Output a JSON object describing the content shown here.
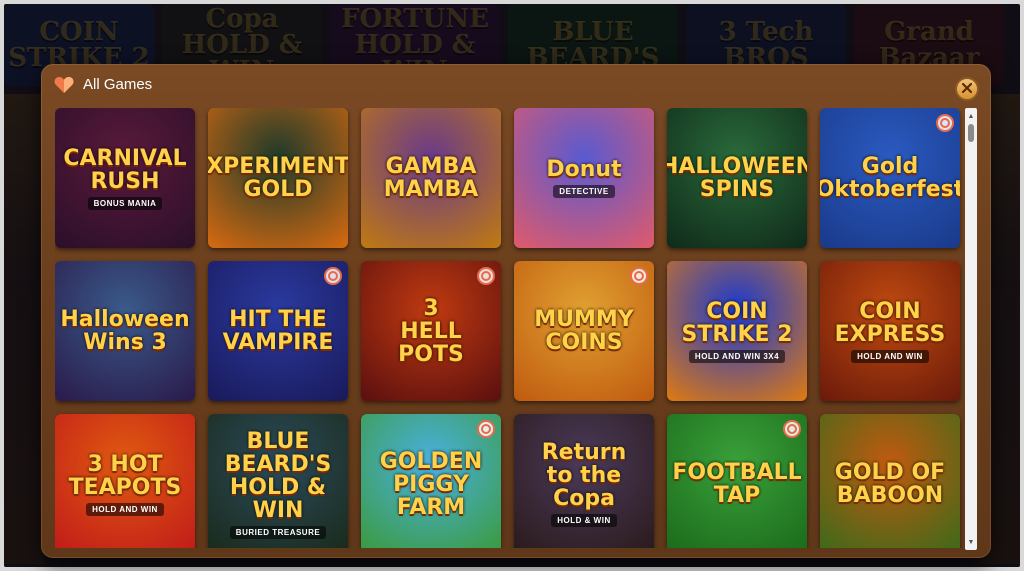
{
  "background": {
    "tiles": [
      {
        "label": "COIN STRIKE 2",
        "color": "#1e2c66"
      },
      {
        "label": "Copa HOLD & WIN",
        "color": "#2a2a2a"
      },
      {
        "label": "FORTUNE HOLD & WIN",
        "color": "#3a1a4a"
      },
      {
        "label": "BLUE BEARD'S",
        "color": "#143a2a"
      },
      {
        "label": "3 Tech BROS",
        "color": "#1a2a5a"
      },
      {
        "label": "Grand Bazaar",
        "color": "#4a1a2a"
      }
    ]
  },
  "modal": {
    "title": "All Games",
    "close_label": "×",
    "accent": "#d8922f"
  },
  "games": [
    {
      "title": "CARNIVAL\nRUSH",
      "sub": "BONUS MANIA",
      "bg1": "#5a1a3a",
      "bg2": "#2a0f2a",
      "favorite": false
    },
    {
      "title": "XPERIMENT\nGOLD",
      "sub": "",
      "bg1": "#1e3a2a",
      "bg2": "#d86a10",
      "favorite": false
    },
    {
      "title": "GAMBA\nMAMBA",
      "sub": "",
      "bg1": "#6a3a8a",
      "bg2": "#c07a10",
      "favorite": false
    },
    {
      "title": "Donut",
      "sub": "DETECTIVE",
      "bg1": "#5a5ad0",
      "bg2": "#e05a6a",
      "favorite": false
    },
    {
      "title": "HALLOWEEN\nSPINS",
      "sub": "",
      "bg1": "#2a6a3a",
      "bg2": "#0f2a1a",
      "favorite": false
    },
    {
      "title": "Gold\nOktoberfest",
      "sub": "",
      "bg1": "#2a5ac0",
      "bg2": "#1a3a8a",
      "favorite": true
    },
    {
      "title": "Halloween\nWins 3",
      "sub": "",
      "bg1": "#3a5a8a",
      "bg2": "#2a1a4a",
      "favorite": false
    },
    {
      "title": "HIT THE\nVAMPIRE",
      "sub": "",
      "bg1": "#2a3aa0",
      "bg2": "#1a1a5a",
      "favorite": true
    },
    {
      "title": "3\nHELL\nPOTS",
      "sub": "",
      "bg1": "#c03a10",
      "bg2": "#5a0f0f",
      "favorite": true
    },
    {
      "title": "MUMMY\nCOINS",
      "sub": "",
      "bg1": "#e0a030",
      "bg2": "#c05a10",
      "favorite": true
    },
    {
      "title": "COIN\nSTRIKE 2",
      "sub": "HOLD AND WIN 3X4",
      "bg1": "#1a3ad0",
      "bg2": "#e07a10",
      "favorite": false
    },
    {
      "title": "COIN\nEXPRESS",
      "sub": "HOLD AND WIN",
      "bg1": "#c04a10",
      "bg2": "#6a1a0a",
      "favorite": false
    },
    {
      "title": "3 HOT\nTEAPOTS",
      "sub": "HOLD AND WIN",
      "bg1": "#e05a10",
      "bg2": "#c01a1a",
      "favorite": false
    },
    {
      "title": "BLUE BEARD'S\nHOLD & WIN",
      "sub": "BURIED TREASURE",
      "bg1": "#2a4a5a",
      "bg2": "#1a2a1a",
      "favorite": false
    },
    {
      "title": "GOLDEN\nPIGGY FARM",
      "sub": "",
      "bg1": "#4ab0e0",
      "bg2": "#3a9a3a",
      "favorite": true
    },
    {
      "title": "Return\nto the\nCopa",
      "sub": "HOLD & WIN",
      "bg1": "#4a3a5a",
      "bg2": "#2a1a1a",
      "favorite": false
    },
    {
      "title": "FOOTBALL\nTAP",
      "sub": "",
      "bg1": "#3aa03a",
      "bg2": "#1a6a1a",
      "favorite": true
    },
    {
      "title": "GOLD OF\nBABOON",
      "sub": "",
      "bg1": "#c05a10",
      "bg2": "#3a6a1a",
      "favorite": false
    }
  ],
  "scrollbar": {
    "up": "▲",
    "down": "▼"
  }
}
